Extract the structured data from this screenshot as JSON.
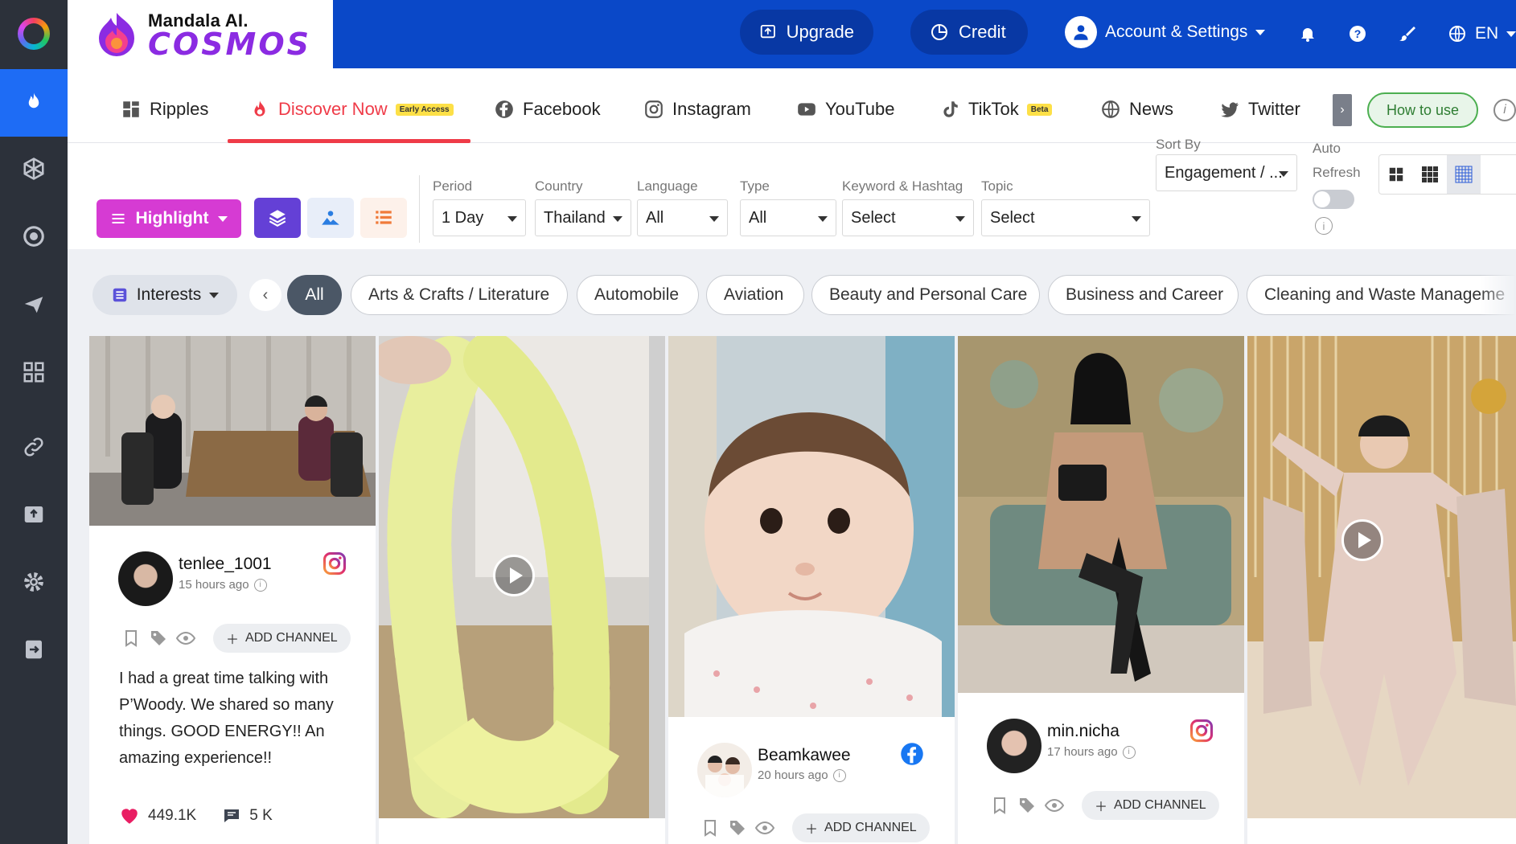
{
  "brand": {
    "line1": "Mandala AI.",
    "line2": "COSMOS"
  },
  "topbar": {
    "upgrade": "Upgrade",
    "credit": "Credit",
    "account": "Account & Settings",
    "language": "EN"
  },
  "tabs": {
    "ripples": "Ripples",
    "discover": "Discover Now",
    "discover_badge": "Early Access",
    "facebook": "Facebook",
    "instagram": "Instagram",
    "youtube": "YouTube",
    "tiktok": "TikTok",
    "tiktok_badge": "Beta",
    "news": "News",
    "twitter": "Twitter",
    "how_to_use": "How to use"
  },
  "filters": {
    "highlight": "Highlight",
    "period_label": "Period",
    "period_value": "1 Day",
    "country_label": "Country",
    "country_value": "Thailand",
    "language_label": "Language",
    "language_value": "All",
    "type_label": "Type",
    "type_value": "All",
    "keyword_label": "Keyword & Hashtag",
    "keyword_value": "Select",
    "topic_label": "Topic",
    "topic_value": "Select",
    "sort_label": "Sort By",
    "sort_value": "Engagement / ...",
    "auto_label": "Auto",
    "refresh_label": "Refresh"
  },
  "interests": {
    "button": "Interests",
    "chips": [
      "All",
      "Arts & Crafts / Literature",
      "Automobile",
      "Aviation",
      "Beauty and Personal Care",
      "Business and Career",
      "Cleaning and Waste Manageme"
    ]
  },
  "cards": [
    {
      "account": "tenlee_1001",
      "ago": "15 hours ago",
      "platform": "instagram",
      "add": "ADD CHANNEL",
      "caption": "I had a great time talking with P’Woody. We shared so many things. GOOD ENERGY!! An amazing experience!!",
      "likes": "449.1K",
      "comments": "5 K"
    },
    {
      "account": "",
      "ago": "",
      "platform": "tiktok",
      "add": "",
      "caption": "",
      "likes": "",
      "comments": ""
    },
    {
      "account": "Beamkawee",
      "ago": "20 hours ago",
      "platform": "facebook",
      "add": "ADD CHANNEL",
      "caption": "",
      "likes": "",
      "comments": ""
    },
    {
      "account": "min.nicha",
      "ago": "17 hours ago",
      "platform": "instagram",
      "add": "ADD CHANNEL",
      "caption": "",
      "likes": "",
      "comments": ""
    },
    {
      "account": "",
      "ago": "",
      "platform": "tiktok",
      "add": "",
      "caption": "",
      "likes": "",
      "comments": ""
    }
  ],
  "colors": {
    "topbar": "#0a48c8",
    "rail": "#2c313a",
    "rail_active": "#1e6cf5",
    "discover": "#ef3b48",
    "highlight": "#d63bd3"
  }
}
